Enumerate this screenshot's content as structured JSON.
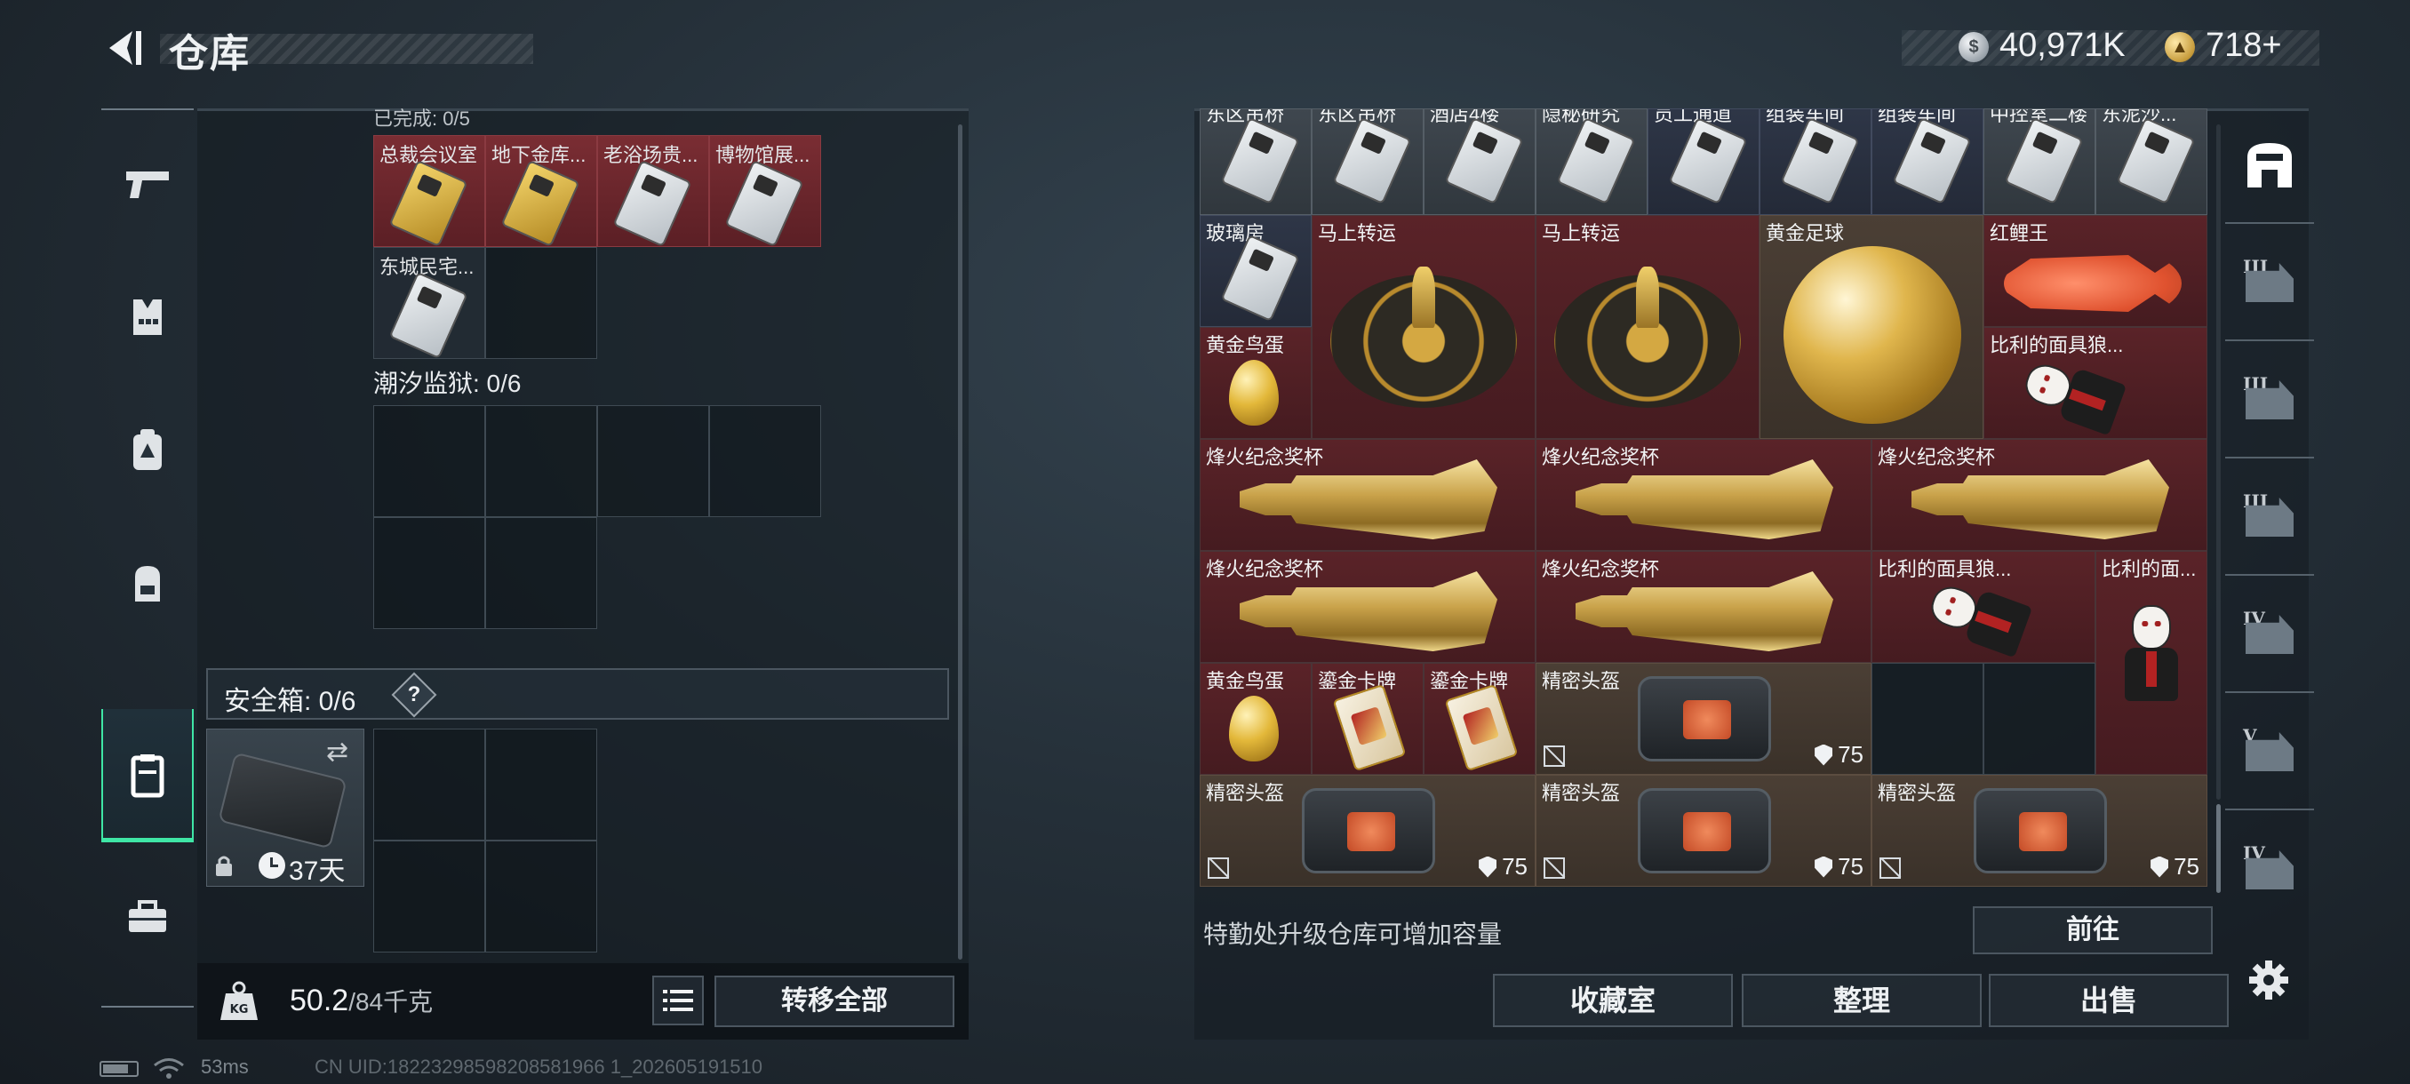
{
  "header": {
    "title": "仓库",
    "currency": {
      "silver_amount": "40,971K",
      "gold_amount": "718",
      "gold_add": "+"
    }
  },
  "left_rail": {
    "items": [
      {
        "icon": "pistol-icon",
        "active": false
      },
      {
        "icon": "armor-vest-icon",
        "active": false
      },
      {
        "icon": "chest-rig-icon",
        "active": false
      },
      {
        "icon": "backpack-icon",
        "active": false
      },
      {
        "icon": "safebox-icon",
        "active": true
      },
      {
        "icon": "toolbox-icon",
        "active": false
      }
    ]
  },
  "left_inventory": {
    "clipped_header": "已完成: 0/5",
    "row1": [
      "总裁会议室",
      "地下金库...",
      "老浴场贵...",
      "博物馆展..."
    ],
    "row2": [
      "东城民宅..."
    ],
    "tide_prison_label": "潮汐监狱: 0/6",
    "safebox": {
      "title": "安全箱: 0/6",
      "help": "?",
      "days": "37天"
    },
    "weight": {
      "current": "50.2",
      "max": "/84千克"
    },
    "transfer_all": "转移全部"
  },
  "stash": {
    "top_row_labels": [
      "东区吊桥",
      "东区吊桥",
      "酒店4楼",
      "隐秘研究",
      "员工通道",
      "组装车间",
      "组装车间",
      "中控室二楼",
      "东泥沙..."
    ],
    "glass_room": "玻璃房",
    "lucky_turntable_1": "马上转运",
    "lucky_turntable_2": "马上转运",
    "golden_ball": "黄金足球",
    "red_koi": "红鲤王",
    "golden_egg_1": "黄金鸟蛋",
    "jigsaw_mask_1": "比利的面具狼...",
    "trophy_1": "烽火纪念奖杯",
    "trophy_2": "烽火纪念奖杯",
    "trophy_3": "烽火纪念奖杯",
    "trophy_4": "烽火纪念奖杯",
    "trophy_5": "烽火纪念奖杯",
    "jigsaw_mask_2": "比利的面具狼...",
    "jigsaw_doll": "比利的面...",
    "golden_egg_2": "黄金鸟蛋",
    "gold_card_1": "鎏金卡牌",
    "gold_card_2": "鎏金卡牌",
    "helmet_1": "精密头盔",
    "helmet_2": "精密头盔",
    "helmet_3": "精密头盔",
    "helmet_4": "精密头盔",
    "durability": "75"
  },
  "footer": {
    "upgrade_hint": "特勤处升级仓库可增加容量",
    "goto": "前往",
    "collection": "收藏室",
    "sort": "整理",
    "sell": "出售"
  },
  "right_rail": {
    "tiers": [
      "III",
      "III",
      "III",
      "IV",
      "V",
      "IV"
    ]
  },
  "status_bar": {
    "ping": "53ms",
    "uid": "CN UID:18223298598208581966 1_202605191510"
  },
  "colors": {
    "accent": "#3fe6a6",
    "item_red": "#5a2328",
    "item_tan": "#4b3f35",
    "item_gray": "#3f474f"
  }
}
